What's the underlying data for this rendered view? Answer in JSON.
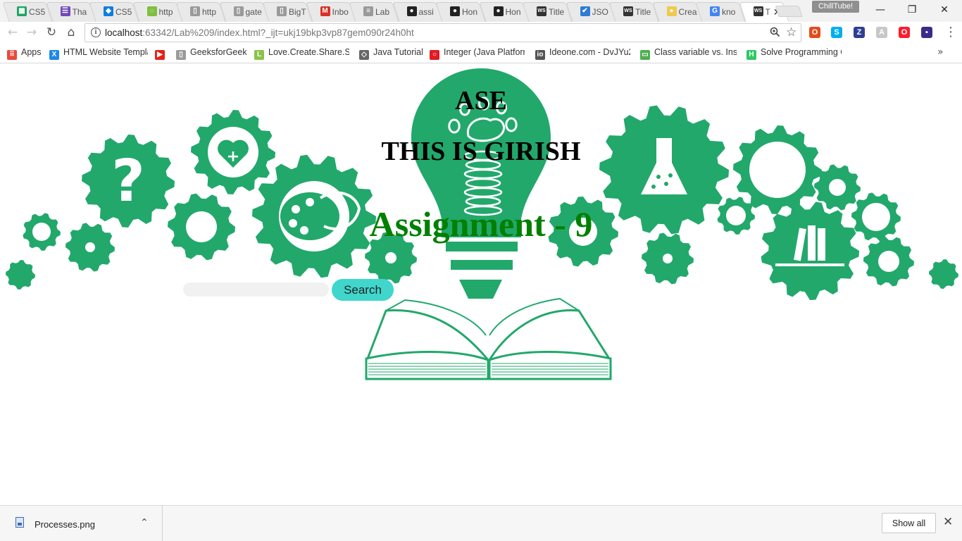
{
  "tabs": [
    {
      "title": "CS5",
      "icon": "sheets-icon",
      "color": "#1fa463"
    },
    {
      "title": "Tha",
      "icon": "forms-icon",
      "color": "#7248b9"
    },
    {
      "title": "CS5",
      "icon": "dropbox-icon",
      "color": "#0d7ee0"
    },
    {
      "title": "http",
      "icon": "loading-icon",
      "color": "#7fbf3f"
    },
    {
      "title": "http",
      "icon": "page-icon",
      "color": "#9a9a9a"
    },
    {
      "title": "gate",
      "icon": "page-icon",
      "color": "#9a9a9a"
    },
    {
      "title": "BigT",
      "icon": "page-icon",
      "color": "#9a9a9a"
    },
    {
      "title": "Inbo",
      "icon": "gmail-icon",
      "color": "#d93025"
    },
    {
      "title": "Lab",
      "icon": "tag-icon",
      "color": "#9a9a9a"
    },
    {
      "title": "assi",
      "icon": "github-icon",
      "color": "#222222"
    },
    {
      "title": "Hon",
      "icon": "github-icon",
      "color": "#222222"
    },
    {
      "title": "Hon",
      "icon": "github-icon",
      "color": "#222222"
    },
    {
      "title": "Title",
      "icon": "webstorm-icon",
      "color": "#333333"
    },
    {
      "title": "JSO",
      "icon": "checkbox-icon",
      "color": "#2e7bd6"
    },
    {
      "title": "Title",
      "icon": "webstorm-icon",
      "color": "#333333"
    },
    {
      "title": "Crea",
      "icon": "bulb-icon",
      "color": "#f2c94c"
    },
    {
      "title": "kno",
      "icon": "google-icon",
      "color": "#4285f4"
    },
    {
      "title": "T",
      "icon": "webstorm-icon",
      "color": "#333333"
    }
  ],
  "extension_badge": "ChillTube!",
  "window_controls": {
    "minimize": "—",
    "restore": "❐",
    "close": "✕"
  },
  "toolbar": {
    "back": "←",
    "forward": "→",
    "reload": "↻",
    "home": "⌂",
    "url_host": "localhost",
    "url_rest": ":63342/Lab%209/index.html?_ijt=ukj19bkp3vp87gem090r24h0ht",
    "zoom_icon": "zoom-icon",
    "star_icon": "bookmark-star-icon",
    "menu": "⋮"
  },
  "extensions": [
    {
      "name": "office-icon",
      "glyph": "O",
      "color": "#e64a19"
    },
    {
      "name": "skype-icon",
      "glyph": "S",
      "color": "#00aff0"
    },
    {
      "name": "zotero-icon",
      "glyph": "Z",
      "color": "#2f3f8f"
    },
    {
      "name": "pdf-icon",
      "glyph": "A",
      "color": "#c7c7c7"
    },
    {
      "name": "opera-icon",
      "glyph": "O",
      "color": "#ff1b2d"
    },
    {
      "name": "app-icon",
      "glyph": "▪",
      "color": "#3b2a8a"
    }
  ],
  "bookmarks": [
    {
      "label": "Apps",
      "icon": "apps-grid-icon",
      "color": "#e84b3c"
    },
    {
      "label": "HTML Website Templa",
      "icon": "bookmark-x-icon",
      "color": "#1e88e5"
    },
    {
      "label": "",
      "icon": "youtube-icon",
      "color": "#e62117"
    },
    {
      "label": "GeeksforGeeks",
      "icon": "page-icon",
      "color": "#9a9a9a"
    },
    {
      "label": "Love.Create.Share.Sho",
      "icon": "l-icon",
      "color": "#8bc34a"
    },
    {
      "label": "Java Tutorial",
      "icon": "diamond-icon",
      "color": "#666666"
    },
    {
      "label": "Integer (Java Platform",
      "icon": "oracle-icon",
      "color": "#e11b22"
    },
    {
      "label": "Ideone.com - DvJYu2",
      "icon": "ideone-icon",
      "color": "#555555"
    },
    {
      "label": "Class variable vs. Insta",
      "icon": "laptop-icon",
      "color": "#4caf50"
    },
    {
      "label": "Solve Programming C",
      "icon": "hackerrank-icon",
      "color": "#2ec866"
    }
  ],
  "bookmarks_more": "»",
  "page": {
    "heading1": "ASE",
    "heading2": "THIS IS GIRISH",
    "heading3": "Assignment - 9",
    "heading3_color": "#008000",
    "search_placeholder": "",
    "search_button": "Search",
    "search_button_color": "#40d6cc",
    "theme_green": "#22a86b"
  },
  "downloads": {
    "file_name": "Processes.png",
    "show_all": "Show all",
    "close": "✕",
    "caret": "⌃"
  }
}
